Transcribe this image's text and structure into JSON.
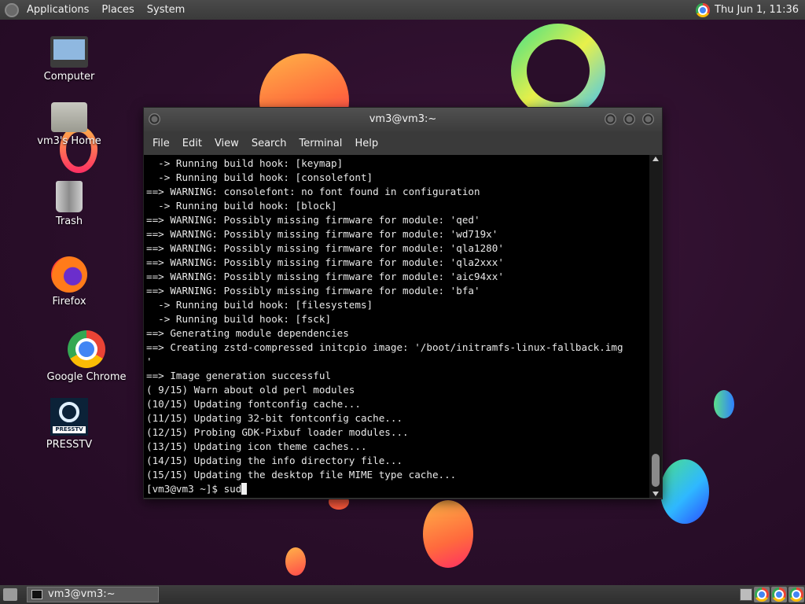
{
  "top_panel": {
    "menu_applications": "Applications",
    "menu_places": "Places",
    "menu_system": "System",
    "clock": "Thu Jun  1, 11:36"
  },
  "desktop_icons": {
    "computer": "Computer",
    "home": "vm3's Home",
    "trash": "Trash",
    "firefox": "Firefox",
    "chrome": "Google Chrome",
    "presstv": "PRESSTV"
  },
  "terminal": {
    "title": "vm3@vm3:~",
    "menu": [
      "File",
      "Edit",
      "View",
      "Search",
      "Terminal",
      "Help"
    ],
    "output": "  -> Running build hook: [keymap]\n  -> Running build hook: [consolefont]\n==> WARNING: consolefont: no font found in configuration\n  -> Running build hook: [block]\n==> WARNING: Possibly missing firmware for module: 'qed'\n==> WARNING: Possibly missing firmware for module: 'wd719x'\n==> WARNING: Possibly missing firmware for module: 'qla1280'\n==> WARNING: Possibly missing firmware for module: 'qla2xxx'\n==> WARNING: Possibly missing firmware for module: 'aic94xx'\n==> WARNING: Possibly missing firmware for module: 'bfa'\n  -> Running build hook: [filesystems]\n  -> Running build hook: [fsck]\n==> Generating module dependencies\n==> Creating zstd-compressed initcpio image: '/boot/initramfs-linux-fallback.img\n'\n==> Image generation successful\n( 9/15) Warn about old perl modules\n(10/15) Updating fontconfig cache...\n(11/15) Updating 32-bit fontconfig cache...\n(12/15) Probing GDK-Pixbuf loader modules...\n(13/15) Updating icon theme caches...\n(14/15) Updating the info directory file...\n(15/15) Updating the desktop file MIME type cache...",
    "prompt": "[vm3@vm3 ~]$ ",
    "input": "sud"
  },
  "bottom_panel": {
    "taskbar_terminal": "vm3@vm3:~"
  },
  "colors": {
    "desktop_bg": "#2a0e2a",
    "panel_bg": "#3a3a3a",
    "terminal_bg": "#000000",
    "terminal_fg": "#e8e8e8"
  },
  "icons": {
    "apps": "applications-menu-icon",
    "tray": "chrome-icon",
    "taskbar": "terminal-icon"
  }
}
